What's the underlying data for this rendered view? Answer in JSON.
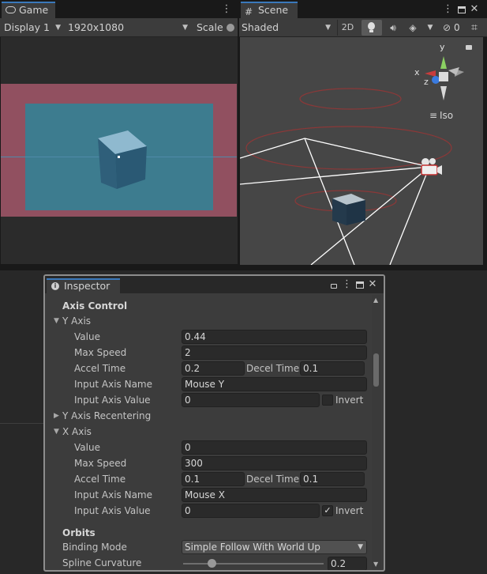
{
  "game": {
    "tab_label": "Game",
    "display": "Display 1",
    "resolution": "1920x1080",
    "scale_label": "Scale",
    "menu_glyph": "⋮"
  },
  "scene": {
    "tab_label": "Scene",
    "shading": "Shaded",
    "btn_2d": "2D",
    "hidden_count": "0",
    "iso_label": "Iso",
    "gizmo_y": "y",
    "gizmo_x": "x",
    "gizmo_z": "z",
    "menu_glyph": "⋮"
  },
  "inspector": {
    "tab_label": "Inspector",
    "section_title": "Axis Control",
    "y_axis": {
      "label": "Y Axis",
      "value_label": "Value",
      "value": "0.44",
      "max_speed_label": "Max Speed",
      "max_speed": "2",
      "accel_label": "Accel Time",
      "accel": "0.2",
      "decel_label": "Decel Time",
      "decel": "0.1",
      "axis_name_label": "Input Axis Name",
      "axis_name": "Mouse Y",
      "axis_value_label": "Input Axis Value",
      "axis_value": "0",
      "invert_label": "Invert",
      "invert": false
    },
    "y_recentering_label": "Y Axis Recentering",
    "x_axis": {
      "label": "X Axis",
      "value_label": "Value",
      "value": "0",
      "max_speed_label": "Max Speed",
      "max_speed": "300",
      "accel_label": "Accel Time",
      "accel": "0.1",
      "decel_label": "Decel Time",
      "decel": "0.1",
      "axis_name_label": "Input Axis Name",
      "axis_name": "Mouse X",
      "axis_value_label": "Input Axis Value",
      "axis_value": "0",
      "invert_label": "Invert",
      "invert": true
    },
    "orbits_title": "Orbits",
    "binding_mode_label": "Binding Mode",
    "binding_mode": "Simple Follow With World Up",
    "spline_label": "Spline Curvature",
    "spline_value": "0.2",
    "spline_fraction": 0.2
  },
  "colors": {
    "accent": "#3a79bb",
    "gate_red": "#9b4852",
    "camera_view": "#35778f",
    "cube": "#5e94ae",
    "panel": "#3c3c3c"
  }
}
